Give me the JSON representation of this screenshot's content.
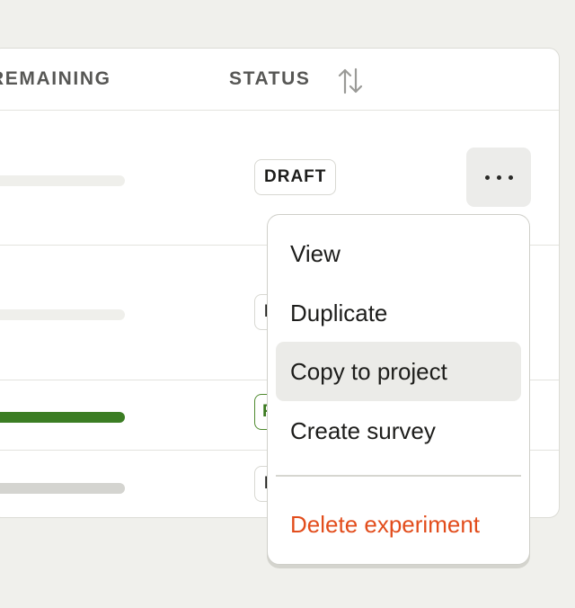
{
  "table": {
    "columns": {
      "remaining": "REMAINING",
      "status": "STATUS"
    },
    "rows": [
      {
        "status": "DRAFT",
        "progress": 0,
        "bar_color": "#efefeb"
      },
      {
        "status": "D",
        "progress": 0,
        "bar_color": "#efefeb"
      },
      {
        "status": "RU",
        "progress": 1,
        "bar_color": "#3b7d23"
      },
      {
        "status": "D",
        "progress": 1,
        "bar_color": "#d4d4d0"
      }
    ]
  },
  "menu": {
    "items": [
      "View",
      "Duplicate",
      "Copy to project",
      "Create survey"
    ],
    "danger_item": "Delete experiment",
    "danger_color": "#e24d1c",
    "highlighted": "Copy to project"
  },
  "icons": {
    "sort": "sort-arrows-icon",
    "more": "ellipsis-icon"
  }
}
